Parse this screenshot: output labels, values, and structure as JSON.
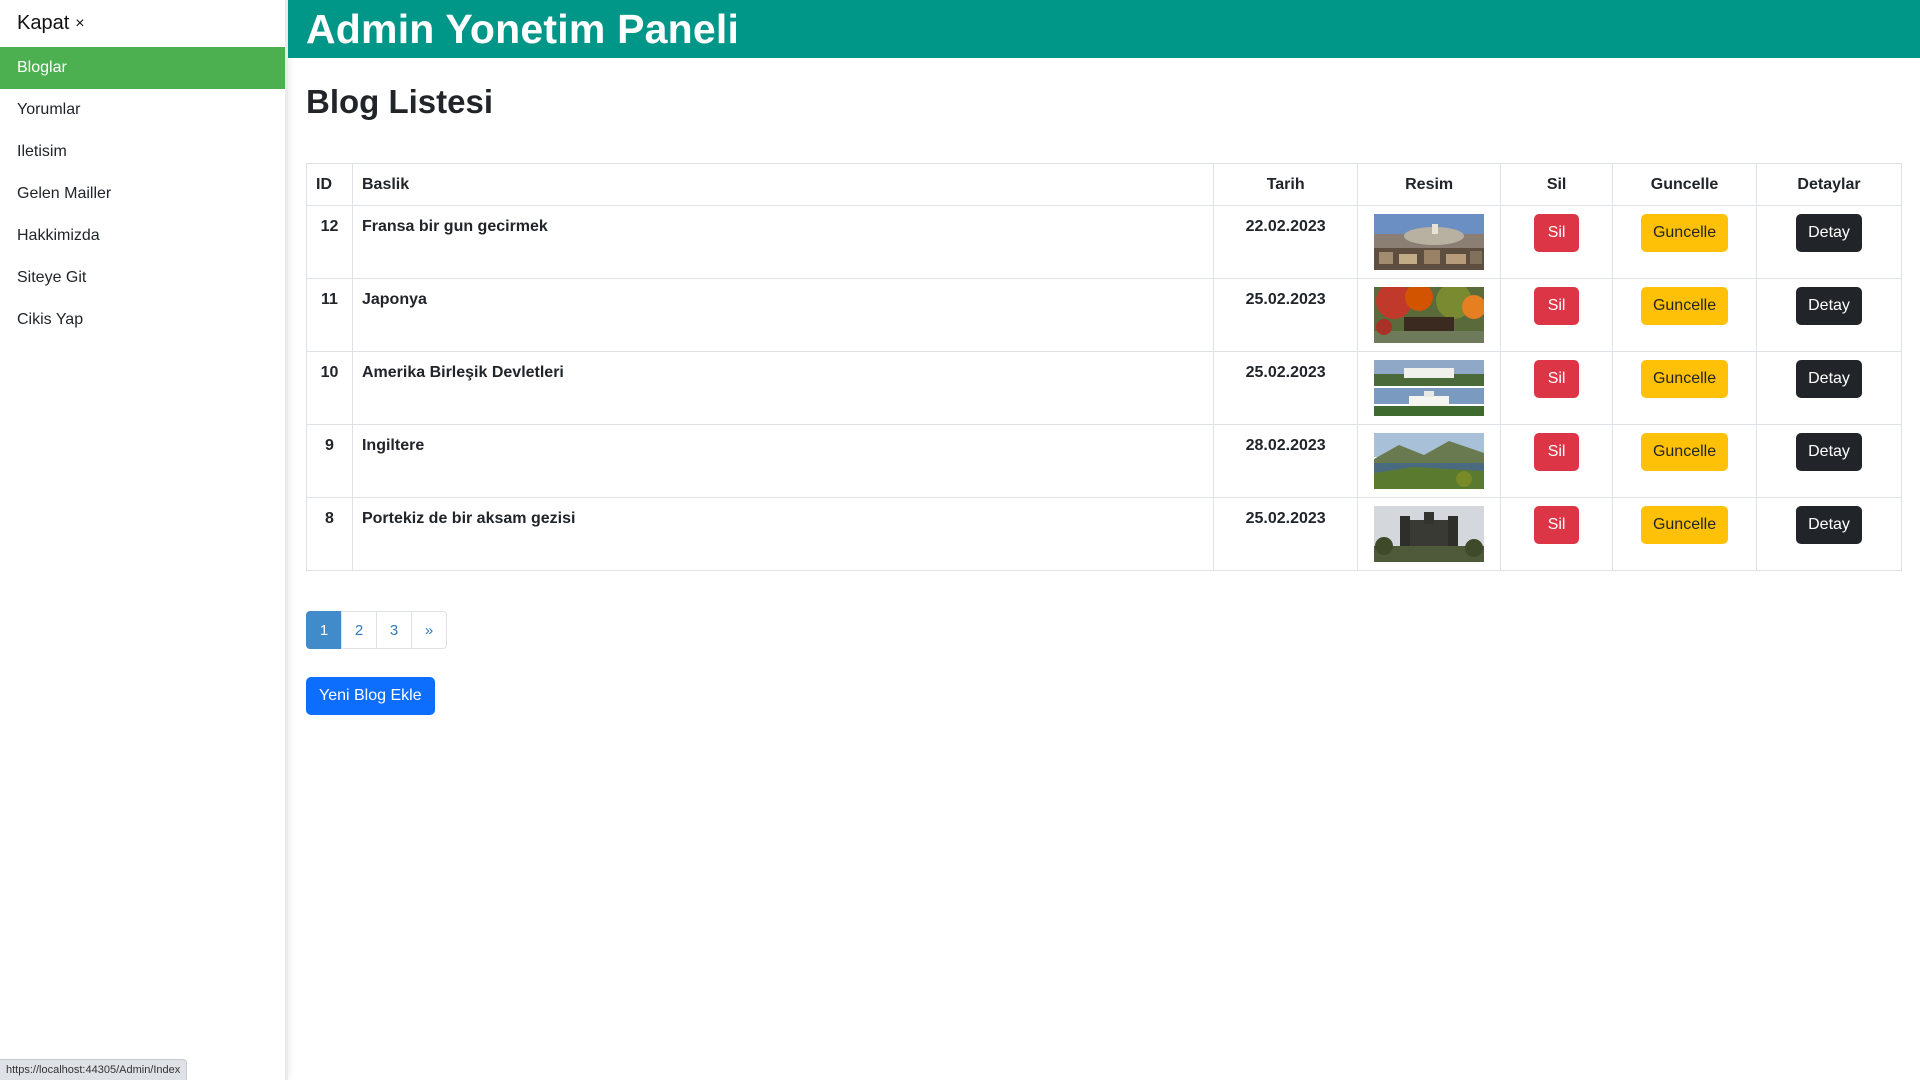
{
  "sidebar": {
    "close_label": "Kapat",
    "close_icon": "×",
    "items": [
      {
        "label": "Bloglar",
        "active": true
      },
      {
        "label": "Yorumlar"
      },
      {
        "label": "Iletisim"
      },
      {
        "label": "Gelen Mailler"
      },
      {
        "label": "Hakkimizda"
      },
      {
        "label": "Siteye Git"
      },
      {
        "label": "Cikis Yap"
      }
    ]
  },
  "header": {
    "title": "Admin Yonetim Paneli"
  },
  "main": {
    "title": "Blog Listesi",
    "columns": [
      "ID",
      "Baslik",
      "Tarih",
      "Resim",
      "Sil",
      "Guncelle",
      "Detaylar"
    ],
    "rows": [
      {
        "id": "12",
        "title": "Fransa bir gun gecirmek",
        "date": "22.02.2023",
        "image": "paris-cityscape"
      },
      {
        "id": "11",
        "title": "Japonya",
        "date": "25.02.2023",
        "image": "japan-autumn-garden"
      },
      {
        "id": "10",
        "title": "Amerika Birleşik Devletleri",
        "date": "25.02.2023",
        "image": "white-house"
      },
      {
        "id": "9",
        "title": "Ingiltere",
        "date": "28.02.2023",
        "image": "england-lake-hills"
      },
      {
        "id": "8",
        "title": "Portekiz de bir aksam gezisi",
        "date": "25.02.2023",
        "image": "portugal-castle"
      }
    ],
    "buttons": {
      "delete": "Sil",
      "update": "Guncelle",
      "details": "Detay"
    },
    "pagination": {
      "pages": [
        "1",
        "2",
        "3"
      ],
      "next": "»",
      "current": "1"
    },
    "add_button": "Yeni Blog Ekle"
  },
  "status_bar": {
    "url": "https://localhost:44305/Admin/Index"
  },
  "colors": {
    "header": "#009688",
    "sidebar_active": "#4caf50",
    "danger": "#dc3545",
    "warning": "#ffc107",
    "dark": "#212529",
    "primary": "#0d6efd",
    "pagination_active": "#428bca"
  }
}
